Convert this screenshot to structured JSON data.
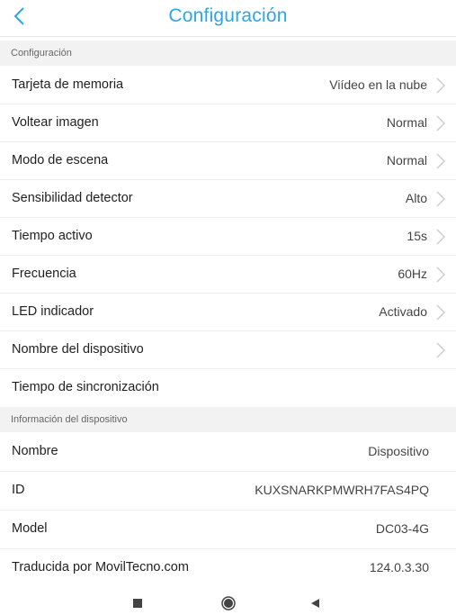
{
  "header": {
    "title": "Configuración",
    "back_icon": "chevron-left-icon",
    "accent": "#2ba6e6"
  },
  "sections": {
    "config": "Configuración",
    "device_info": "Información del dispositivo"
  },
  "settings": [
    {
      "label": "Tarjeta de memoria",
      "value": "Viídeo en la nube"
    },
    {
      "label": "Voltear imagen",
      "value": "Normal"
    },
    {
      "label": "Modo de escena",
      "value": "Normal"
    },
    {
      "label": "Sensibilidad detector",
      "value": "Alto"
    },
    {
      "label": "Tiempo activo",
      "value": "15s"
    },
    {
      "label": "Frecuencia",
      "value": "60Hz"
    },
    {
      "label": "LED indicador",
      "value": "Activado"
    },
    {
      "label": "Nombre del dispositivo",
      "value": ""
    },
    {
      "label": "Tiempo de sincronización",
      "value": ""
    }
  ],
  "device_info": [
    {
      "label": "Nombre",
      "value": "Dispositivo"
    },
    {
      "label": "ID",
      "value": "KUXSNARKPMWRH7FAS4PQ"
    },
    {
      "label": "Model",
      "value": "DC03-4G"
    },
    {
      "label": "Traducida por MovilTecno.com",
      "value": "124.0.3.30"
    }
  ],
  "navbar": {
    "recents": "square-icon",
    "home": "circle-icon",
    "back": "triangle-back-icon"
  }
}
